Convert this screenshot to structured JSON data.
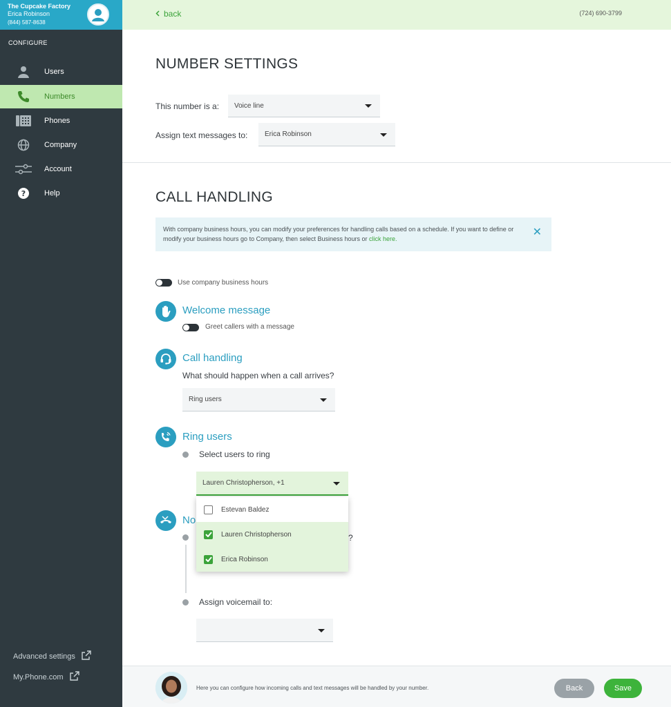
{
  "sidebar": {
    "company": "The Cupcake Factory",
    "user": "Erica Robinson",
    "phone": "(844) 587-8638",
    "section_label": "CONFIGURE",
    "items": [
      {
        "label": "Users",
        "icon": "user-icon"
      },
      {
        "label": "Numbers",
        "icon": "phone-icon",
        "active": true
      },
      {
        "label": "Phones",
        "icon": "desk-phone-icon"
      },
      {
        "label": "Company",
        "icon": "globe-icon"
      },
      {
        "label": "Account",
        "icon": "sliders-icon"
      },
      {
        "label": "Help",
        "icon": "help-icon"
      }
    ],
    "advanced_settings": "Advanced settings",
    "my_phone": "My.Phone.com"
  },
  "header": {
    "back_label": "back",
    "phone_number": "(724) 690-3799"
  },
  "number_settings": {
    "title": "NUMBER SETTINGS",
    "type_label": "This number is a:",
    "type_value": "Voice line",
    "assign_label": "Assign text messages to:",
    "assign_value": "Erica Robinson"
  },
  "call_handling": {
    "title": "CALL HANDLING",
    "info_text": "With company business hours, you can modify your preferences for handling calls based on a schedule. If you want to define or modify your business hours go to Company, then select Business hours or",
    "info_link": "click here.",
    "business_hours_toggle": "Use company business hours",
    "welcome": {
      "title": "Welcome message",
      "toggle_label": "Greet callers with a message"
    },
    "handling": {
      "title": "Call handling",
      "question": "What should happen when a call arrives?",
      "value": "Ring users"
    },
    "ring_users": {
      "title": "Ring users",
      "step_label": "Select users to ring",
      "selected": "Lauren Christopherson, +1",
      "options": [
        {
          "name": "Estevan Baldez",
          "checked": false
        },
        {
          "name": "Lauren Christopherson",
          "checked": true
        },
        {
          "name": "Erica Robinson",
          "checked": true
        }
      ]
    },
    "no_answer": {
      "title_fragment": "No",
      "question_fragment": "?",
      "voicemail_label": "Assign voicemail to:",
      "voicemail_value": ""
    }
  },
  "footer": {
    "hint": "Here you can configure how incoming calls and text messages will be handled by your number.",
    "back_button": "Back",
    "save_button": "Save"
  },
  "colors": {
    "sidebar_bg": "#2f3a40",
    "brand_blue": "#29a8c8",
    "accent_green": "#3db33b",
    "header_green": "#e5f6dc"
  }
}
